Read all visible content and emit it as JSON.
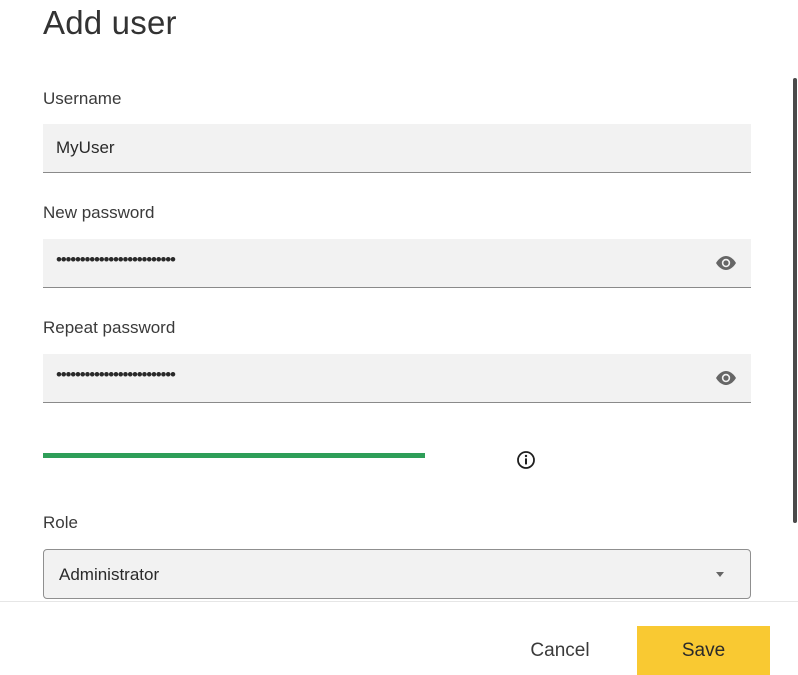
{
  "dialog": {
    "title": "Add user"
  },
  "username": {
    "label": "Username",
    "value": "MyUser"
  },
  "new_password": {
    "label": "New password",
    "value_masked": "•••••••••••••••••••••••••",
    "toggle_icon": "eye-icon"
  },
  "repeat_password": {
    "label": "Repeat password",
    "value_masked": "•••••••••••••••••••••••••",
    "toggle_icon": "eye-icon"
  },
  "password_strength": {
    "level": 0.54,
    "color": "#2e9e58",
    "info_icon": "info-icon"
  },
  "role": {
    "label": "Role",
    "selected": "Administrator"
  },
  "footer": {
    "cancel_label": "Cancel",
    "save_label": "Save",
    "save_color": "#f9c932"
  }
}
